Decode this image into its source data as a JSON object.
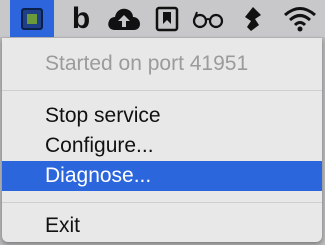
{
  "menubar": {
    "icons": [
      "app-status-icon",
      "b-app-icon",
      "cloud-upload-icon",
      "bookmark-icon",
      "glasses-icon",
      "pen-nib-icon",
      "wifi-icon"
    ],
    "b_label": "b",
    "glasses_label": "ඉ"
  },
  "menu": {
    "status": "Started on port 41951",
    "stop": "Stop service",
    "configure": "Configure...",
    "diagnose": "Diagnose...",
    "exit": "Exit"
  },
  "colors": {
    "menubar": "#c8c7c9",
    "highlight": "#2c66dc",
    "menu_bg": "#e8e8e8",
    "disabled_text": "#9b9b9b"
  }
}
